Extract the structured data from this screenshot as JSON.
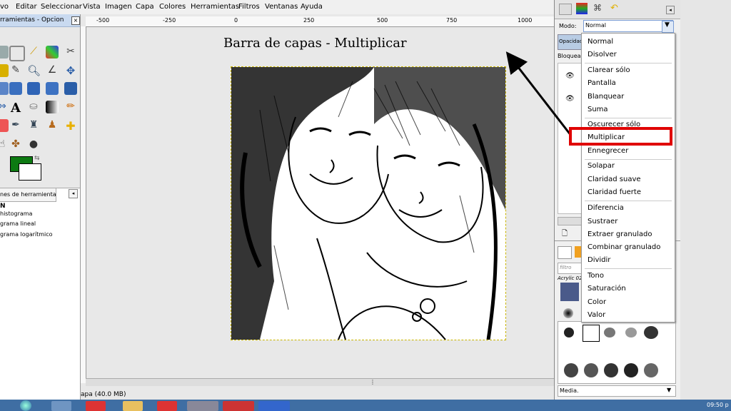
{
  "menubar": {
    "items": [
      "vo",
      "Editar",
      "Seleccionar",
      "Vista",
      "Imagen",
      "Capa",
      "Colores",
      "Herramientas",
      "Filtros",
      "Ventanas",
      "Ayuda"
    ]
  },
  "toolbox": {
    "title": "rramientas - Opcion",
    "fg_color": "#0d7a12",
    "bg_color": "#ffffff",
    "options_tab_label": "nes de herramienta",
    "options_first": "N",
    "options_items": [
      "histograma",
      "grama lineal",
      "grama logarítmico"
    ]
  },
  "canvas": {
    "heading": "Barra de capas - Multiplicar",
    "ruler_labels": [
      "-500",
      "-250",
      "0",
      "250",
      "500",
      "750",
      "1000"
    ],
    "status": "apa (40.0 MB)"
  },
  "layers_dock": {
    "mode_label": "Modo:",
    "mode_value": "Normal",
    "opacity_label": "Opacidad",
    "lock_label": "Bloquear:",
    "filter_placeholder": "filtro",
    "brush_name": "Acrylic 02",
    "brush_select": "Media."
  },
  "mode_menu": {
    "groups": [
      [
        "Normal",
        "Disolver"
      ],
      [
        "Clarear sólo",
        "Pantalla",
        "Blanquear",
        "Suma"
      ],
      [
        "Oscurecer sólo",
        "Multiplicar",
        "Ennegrecer"
      ],
      [
        "Solapar",
        "Claridad suave",
        "Claridad fuerte"
      ],
      [
        "Diferencia",
        "Sustraer",
        "Extraer granulado",
        "Combinar granulado",
        "Dividir"
      ],
      [
        "Tono",
        "Saturación",
        "Color",
        "Valor"
      ]
    ],
    "highlighted": "Multiplicar",
    "highlight_color": "#e00000"
  },
  "taskbar": {
    "clock": "09:50 p"
  }
}
